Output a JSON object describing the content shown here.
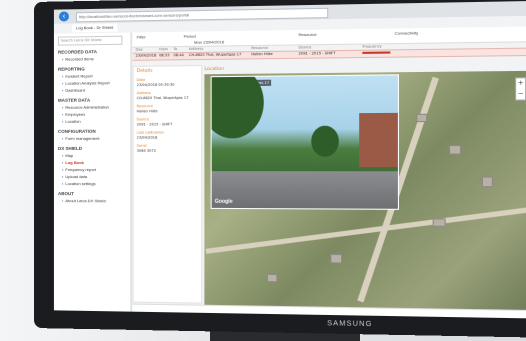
{
  "browser": {
    "title": "Log Book - Dr Shield",
    "url": "http://localhost/lieu-sensors-fleet/m/smart-com-sensors/portal"
  },
  "sidebar": {
    "search": "Search Leica DX Shield",
    "sections": [
      {
        "label": "RECORDED DATA",
        "items": [
          "Recorded Items"
        ]
      },
      {
        "label": "REPORTING",
        "items": [
          "Incident Report",
          "Location Analysis Report",
          "Dashboard"
        ]
      },
      {
        "label": "MASTER DATA",
        "items": [
          "Resource Administration",
          "Employees",
          "Location"
        ]
      },
      {
        "label": "CONFIGURATION",
        "items": [
          "Form management"
        ]
      },
      {
        "label": "DX SHIELD",
        "items": [
          "Map",
          "Log Book",
          "Frequency report",
          "Upload data",
          "Location settings"
        ]
      },
      {
        "label": "ABOUT",
        "items": [
          "About Leica DX Shield"
        ]
      }
    ],
    "active_item": "Log Book"
  },
  "header": {
    "filter_label": "Filter",
    "period_label": "Period",
    "resource_label": "Resource",
    "connectivity_label": "Connectivity",
    "date_value": "Mon 23/04/2018"
  },
  "grid": {
    "columns": [
      "Day",
      "From",
      "To",
      "Address",
      "Resource",
      "Device",
      "Frequency"
    ],
    "selected_row": [
      "23/04/2018",
      "08:33",
      "08:44",
      "CH-8620 Thal, Wupertgas 17",
      "Hollen Hüte",
      "2091 - 2015 - SHIFT"
    ]
  },
  "details": {
    "title": "Details",
    "date_label": "Date",
    "date_value": "23/04/2018 09:30:30",
    "address_label": "Address",
    "address_value": "CH-8620 Thal, Wupertgas 17",
    "resource_label": "Resource",
    "resource_value": "Hollen Hüte",
    "device_label": "Device",
    "device_value": "2091 - 2015 - SHIFT",
    "calibration_label": "Last calibration",
    "calibration_value": "23/04/2018",
    "serial_label": "Serial",
    "serial_value": "3064 3072"
  },
  "map_panel": {
    "title": "Location",
    "google": "Google",
    "street_address": "Ch-8620 Thal, Wupertgas 17"
  },
  "monitor": {
    "brand": "SAMSUNG"
  }
}
